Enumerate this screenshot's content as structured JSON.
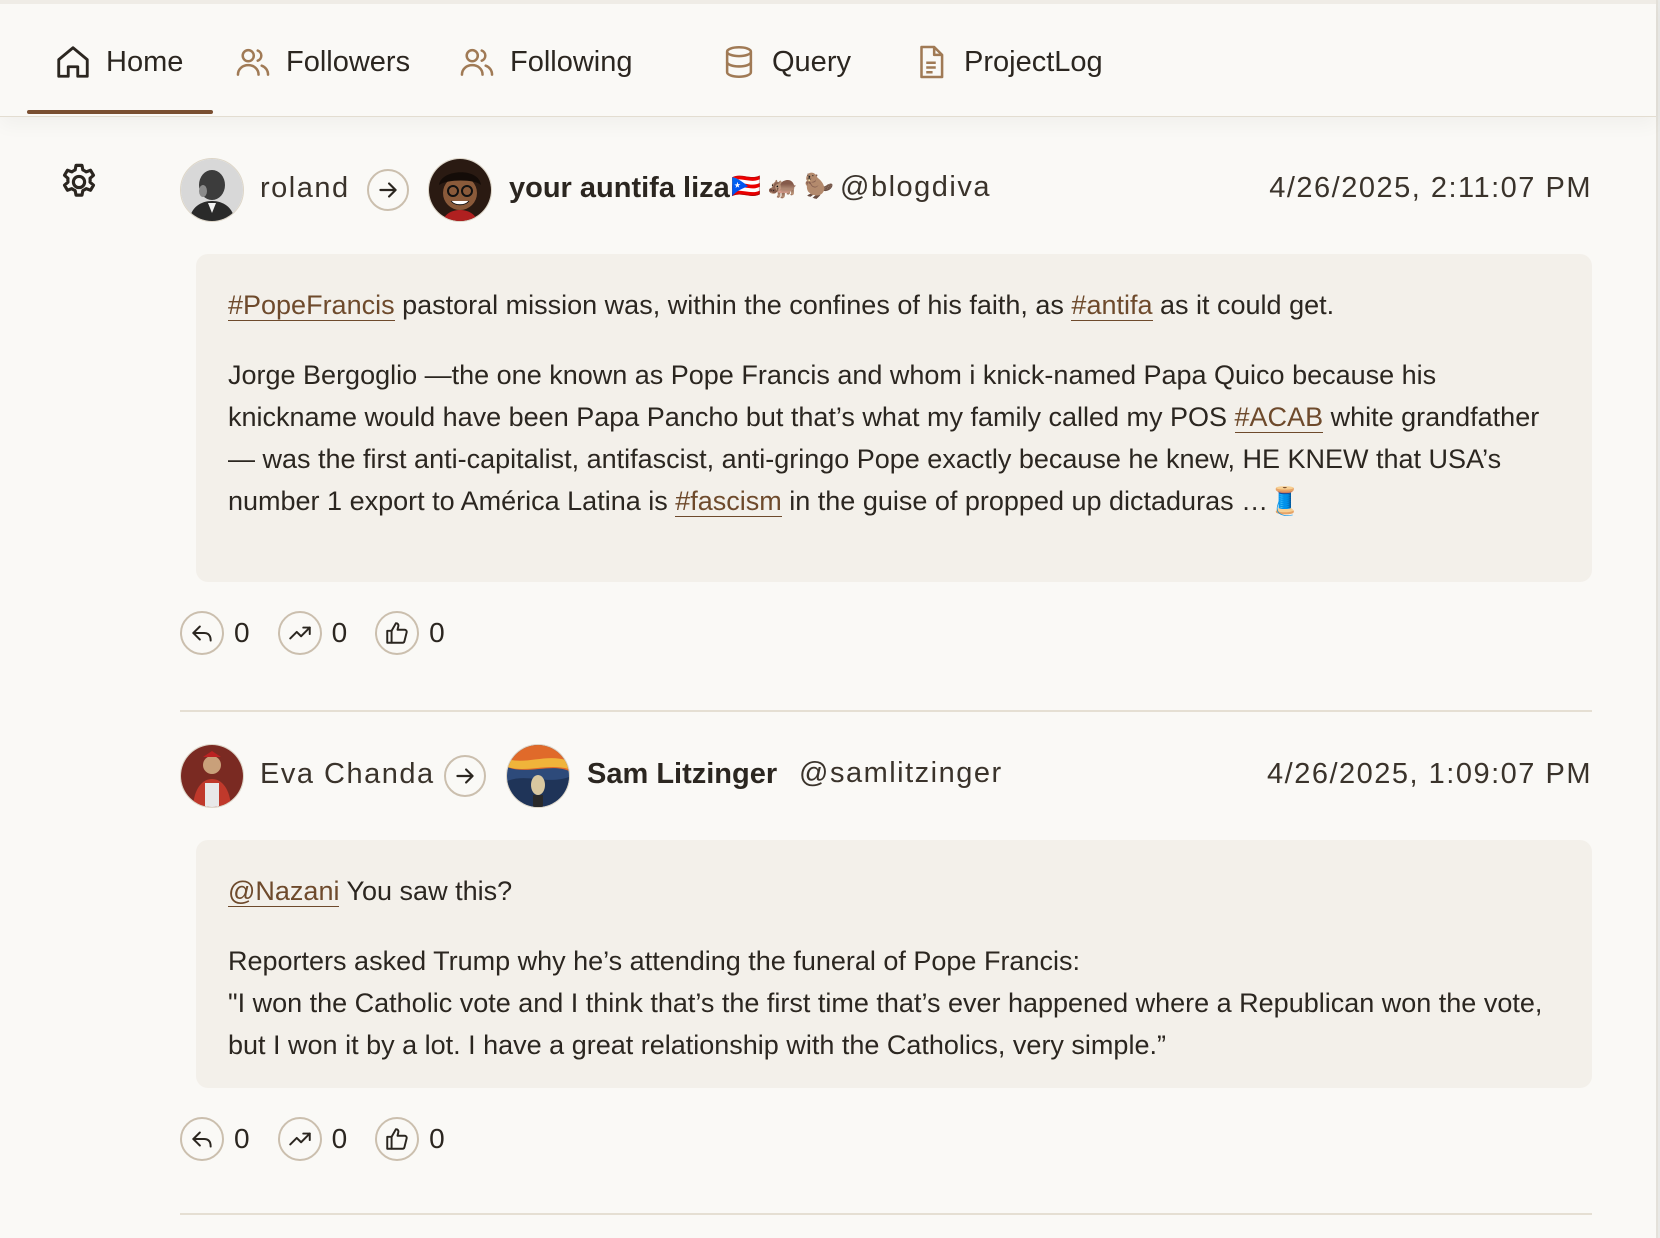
{
  "nav": {
    "tabs": [
      {
        "label": "Home",
        "icon": "home-icon",
        "active": true
      },
      {
        "label": "Followers",
        "icon": "users-icon"
      },
      {
        "label": "Following",
        "icon": "users-icon"
      },
      {
        "label": "Query",
        "icon": "database-icon"
      },
      {
        "label": "ProjectLog",
        "icon": "document-icon"
      }
    ]
  },
  "sidebar": {
    "settings_icon": "gear-icon"
  },
  "colors": {
    "accent": "#7a4f31",
    "link": "#6e4a2c",
    "card": "#f3f0ea",
    "background": "#faf9f6"
  },
  "posts": [
    {
      "from_name": "roland",
      "to_name": "your auntifa liza",
      "to_emojis": "🇵🇷 🦛 🦫",
      "handle": "@blogdiva",
      "timestamp": "4/26/2025, 2:11:07 PM",
      "p1": {
        "tag1": "#PopeFrancis",
        "text1": " pastoral mission was, within the confines of his faith, as ",
        "tag2": "#antifa",
        "text2": " as it could get."
      },
      "p2": {
        "text1": "Jorge Bergoglio —the one known as Pope Francis and whom i knick-named Papa Quico because his knickname would have been Papa Pancho but that’s what my family called my POS ",
        "tag1": "#ACAB",
        "text2": " white grandfather— was the first anti-capitalist, antifascist, anti-gringo Pope exactly because he knew, HE KNEW that USA’s number 1 export to América Latina is ",
        "tag2": "#fascism",
        "text3": " in the guise of propped up dictaduras …🧵"
      },
      "replies": "0",
      "boosts": "0",
      "likes": "0"
    },
    {
      "from_name": "Eva Chanda",
      "to_name": "Sam Litzinger",
      "handle": "@samlitzinger",
      "timestamp": "4/26/2025, 1:09:07 PM",
      "p1": {
        "mention": "@Nazani",
        "text1": " You saw this?"
      },
      "p2": {
        "text1": "Reporters asked Trump why he’s attending the funeral of Pope Francis:",
        "text2": " \"I won the Catholic vote and I think that’s the first time that’s ever happened where a Republican won the vote, but I won it by a lot. I have a great relationship with the Catholics, very simple.”"
      },
      "replies": "0",
      "boosts": "0",
      "likes": "0"
    }
  ]
}
